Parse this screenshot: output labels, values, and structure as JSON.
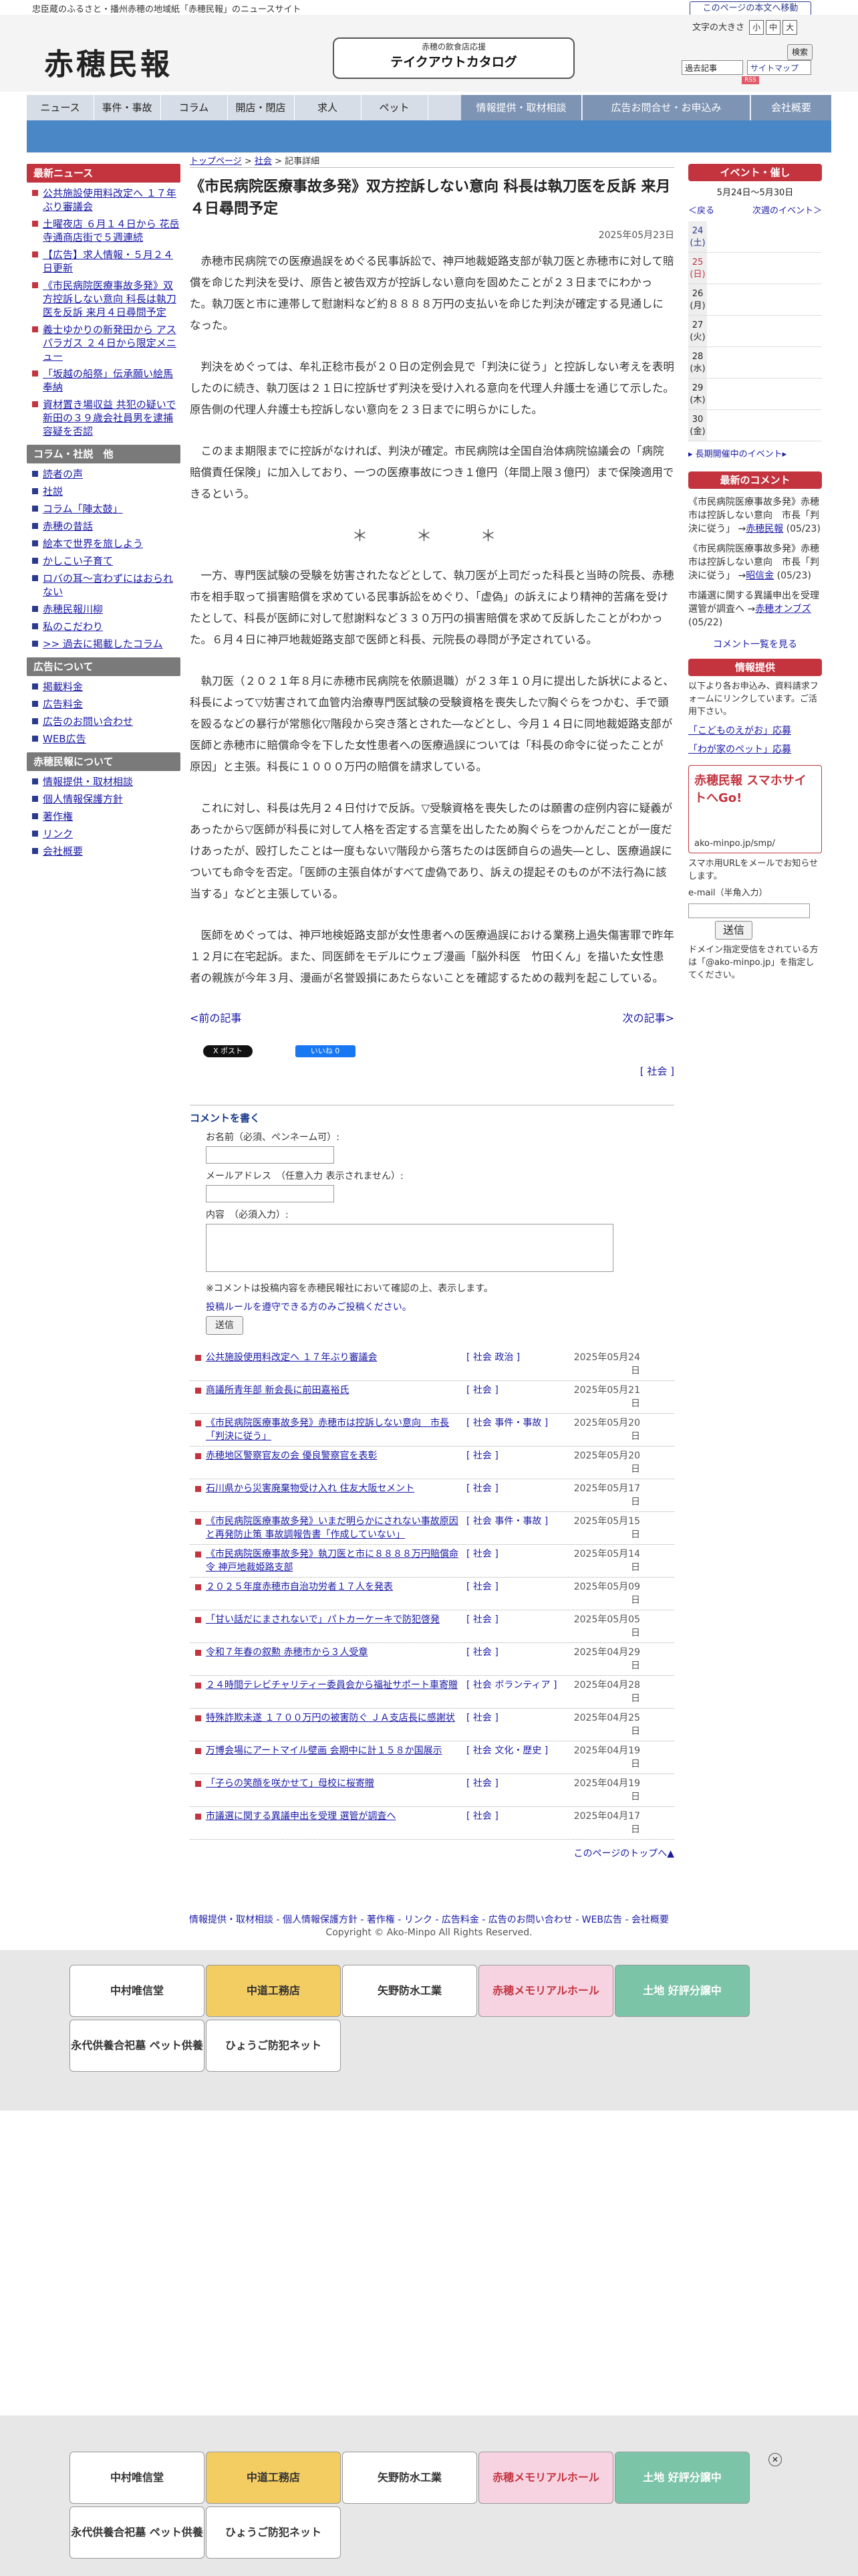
{
  "tagline": "忠臣蔵のふるさと・播州赤穂の地域紙「赤穂民報」のニュースサイト",
  "skip_link": "このページの本文へ移動",
  "logo": "赤穂民報",
  "catalog": {
    "small": "赤穂の飲食店応援",
    "big": "テイクアウトカタログ"
  },
  "fontsize": {
    "label": "文字の大きさ",
    "small": "小",
    "medium": "中",
    "large": "大"
  },
  "search": {
    "button": "検索",
    "select": "過去記事",
    "sitemap": "サイトマップ",
    "rss": "RSS"
  },
  "nav": [
    "ニュース",
    "事件・事故",
    "コラム",
    "開店・閉店",
    "求人",
    "ペット",
    "情報提供・取材相談",
    "広告お問合せ・お申込み",
    "会社概要"
  ],
  "left": {
    "latest_head": "最新ニュース",
    "latest": [
      "公共施設使用料改定へ １７年ぶり審議会",
      "土曜夜店 ６月１４日から 花岳寺通商店街で５週連続",
      "【広告】求人情報・５月２４日更新",
      "《市民病院医療事故多発》双方控訴しない意向 科長は執刀医を反訴 来月４日尋問予定",
      "義士ゆかりの新発田から アスパラガス ２４日から限定メニュー",
      "「坂越の船祭」伝承願い絵馬奉納",
      "資材置き場収益 共犯の疑いで新田の３９歳会社員男を逮捕 容疑を否認"
    ],
    "column_head": "コラム・社説　他",
    "columns": [
      "読者の声",
      "社説",
      "コラム「陣太鼓」",
      "赤穂の昔話",
      "絵本で世界を旅しよう",
      "かしこい子育て",
      "ロバの耳〜言わずにはおられない",
      "赤穂民報川柳",
      "私のこだわり",
      ">> 過去に掲載したコラム"
    ],
    "ad_head": "広告について",
    "ads": [
      "掲載料金",
      "広告料金",
      "広告のお問い合わせ",
      "WEB広告"
    ],
    "about_head": "赤穂民報について",
    "about": [
      "情報提供・取材相談",
      "個人情報保護方針",
      "著作権",
      "リンク",
      "会社概要"
    ]
  },
  "breadcrumb": {
    "home": "トップページ",
    "category": "社会",
    "current": "記事詳細"
  },
  "article": {
    "title": "《市民病院医療事故多発》双方控訴しない意向 科長は執刀医を反訴 来月４日尋問予定",
    "date": "2025年05月23日",
    "p1": "赤穂市民病院での医療過誤をめぐる民事訴訟で、神戸地裁姫路支部が執刀医と赤穂市に対して賠償を命じた判決を受け、原告と被告双方が控訴しない意向を固めたことが２３日までにわかった。執刀医と市に連帯して慰謝料など約８８８８万円の支払いを命じた判決が確定する見通しになった。",
    "p2": "判決をめぐっては、牟礼正稔市長が２０日の定例会見で「判決に従う」と控訴しない考えを表明したのに続き、執刀医は２１日に控訴せず判決を受け入れる意向を代理人弁護士を通じて示した。原告側の代理人弁護士も控訴しない意向を２３日までに明らかにした。",
    "p3": "このまま期限までに控訴がなければ、判決が確定。市民病院は全国自治体病院協議会の「病院賠償責任保険」に加入しており、一つの医療事故につき１億円（年間上限３億円）まで保険適用できるという。",
    "stars": "＊　＊　＊",
    "p4": "一方、専門医試験の受験を妨害されたなどとして、執刀医が上司だった科長と当時の院長、赤穂市を相手取って損害賠償を求めている民事訴訟をめぐり、「虚偽」の訴えにより精神的苦痛を受けたとして、科長が医師に対して慰謝料など３３０万円の損害賠償を求めて反訴したことがわかった。６月４日に神戸地裁姫路支部で医師と科長、元院長の尋問が予定されている。",
    "p5": "執刀医（２０２１年８月に赤穂市民病院を依願退職）が２３年１０月に提出した訴状によると、科長によって▽妨害されて血管内治療専門医試験の受験資格を喪失した▽胸ぐらをつかむ、手で頭を殴るなどの暴行が常態化▽階段から突き落とされた―などとし、今月１４日に同地裁姫路支部が医師と赤穂市に賠償命令を下した女性患者への医療過誤については「科長の命令に従ったことが原因」と主張。科長に１０００万円の賠償を請求している。",
    "p6": "これに対し、科長は先月２４日付けで反訴。▽受験資格を喪失したのは願書の症例内容に疑義があったから▽医師が科長に対して人格を否定する言葉を出したため胸ぐらをつかんだことが一度だけあったが、殴打したことは一度もない▽階段から落ちたのは医師自らの過失―とし、医療過誤についても命令を否定。「医師の主張自体がすべて虚偽であり、訴えの提起そのものが不法行為に該当する」などと主張している。",
    "p7": "医師をめぐっては、神戸地検姫路支部が女性患者への医療過誤における業務上過失傷害罪で昨年１２月に在宅起訴。また、同医師をモデルにウェブ漫画「脳外科医　竹田くん」を描いた女性患者の親族が今年３月、漫画が名誉毀損にあたらないことを確認するための裁判を起こしている。",
    "prev": "<前の記事",
    "next": "次の記事>",
    "x_post": "X ポスト",
    "fb_like": "いいね 0",
    "cat_link": "[ 社会 ]"
  },
  "comment": {
    "head": "コメントを書く",
    "name_label": "お名前（必須、ペンネーム可）:",
    "mail_label": "メールアドレス　（任意入力 表示されません）:",
    "body_label": "内容　（必須入力）:",
    "note": "※コメントは投稿内容を赤穂民報社において確認の上、表示します。",
    "rule": "投稿ルールを遵守できる方のみご投稿ください。",
    "submit": "送信"
  },
  "related": [
    {
      "title": "公共施設使用料改定へ １７年ぶり審議会",
      "cat": "[ 社会 政治 ]",
      "date": "2025年05月24日"
    },
    {
      "title": "商議所青年部 新会長に前田嘉裕氏",
      "cat": "[ 社会 ]",
      "date": "2025年05月21日"
    },
    {
      "title": "《市民病院医療事故多発》赤穂市は控訴しない意向　市長「判決に従う」",
      "cat": "[ 社会 事件・事故 ]",
      "date": "2025年05月20日"
    },
    {
      "title": "赤穂地区警察官友の会 優良警察官を表彰",
      "cat": "[ 社会 ]",
      "date": "2025年05月20日"
    },
    {
      "title": "石川県から災害廃棄物受け入れ 住友大阪セメント",
      "cat": "[ 社会 ]",
      "date": "2025年05月17日"
    },
    {
      "title": "《市民病院医療事故多発》いまだ明らかにされない事故原因と再発防止策 事故調報告書「作成していない」",
      "cat": "[ 社会 事件・事故 ]",
      "date": "2025年05月15日"
    },
    {
      "title": "《市民病院医療事故多発》執刀医と市に８８８８万円賠償命令 神戸地裁姫路支部",
      "cat": "[ 社会 ]",
      "date": "2025年05月14日"
    },
    {
      "title": "２０２５年度赤穂市自治功労者１７人を発表",
      "cat": "[ 社会 ]",
      "date": "2025年05月09日"
    },
    {
      "title": "「甘い話だにまされないで」パトカーケーキで防犯啓発",
      "cat": "[ 社会 ]",
      "date": "2025年05月05日"
    },
    {
      "title": "令和７年春の叙勲 赤穂市から３人受章",
      "cat": "[ 社会 ]",
      "date": "2025年04月29日"
    },
    {
      "title": "２４時間テレビチャリティー委員会から福祉サポート車寄贈",
      "cat": "[ 社会 ボランティア ]",
      "date": "2025年04月28日"
    },
    {
      "title": "特殊詐欺未遂 １７００万円の被害防ぐ ＪＡ支店長に感謝状",
      "cat": "[ 社会 ]",
      "date": "2025年04月25日"
    },
    {
      "title": "万博会場にアートマイル壁画 会期中に計１５８か国展示",
      "cat": "[ 社会 文化・歴史 ]",
      "date": "2025年04月19日"
    },
    {
      "title": "「子らの笑顔を咲かせて」母校に桜寄贈",
      "cat": "[ 社会 ]",
      "date": "2025年04月19日"
    },
    {
      "title": "市議選に関する異議申出を受理 選管が調査へ",
      "cat": "[ 社会 ]",
      "date": "2025年04月17日"
    }
  ],
  "backtotop": "このページのトップへ▲",
  "right": {
    "event_head": "イベント・催し",
    "week": "5月24日〜5月30日",
    "prev": "＜戻る",
    "next": "次週のイベント＞",
    "days": [
      {
        "d": "24",
        "w": "(土)",
        "c": "blue"
      },
      {
        "d": "25",
        "w": "(日)",
        "c": "red"
      },
      {
        "d": "26",
        "w": "(月)",
        "c": ""
      },
      {
        "d": "27",
        "w": "(火)",
        "c": ""
      },
      {
        "d": "28",
        "w": "(水)",
        "c": ""
      },
      {
        "d": "29",
        "w": "(木)",
        "c": ""
      },
      {
        "d": "30",
        "w": "(金)",
        "c": ""
      }
    ],
    "long_events": "▸ 長期開催中のイベント▸",
    "comment_head": "最新のコメント",
    "comments": [
      {
        "text": "《市民病院医療事故多発》赤穂市は控訴しない意向　市長「判決に従う」",
        "by": "赤穂民報",
        "date": "(05/23)"
      },
      {
        "text": "《市民病院医療事故多発》赤穂市は控訴しない意向　市長「判決に従う」",
        "by": "昭信金",
        "date": "(05/23)"
      },
      {
        "text": "市議選に関する異議申出を受理 選管が調査へ",
        "by": "赤穂オンブズ",
        "date": "(05/22)"
      }
    ],
    "comment_btn": "コメント一覧を見る",
    "tip_head": "情報提供",
    "tip_text": "以下より各お申込み、資料請求フォームにリンクしています。ご活用下さい。",
    "tip_links": [
      "「こどものえがお」応募",
      "「わが家のペット」応募"
    ],
    "mobile_title": "赤穂民報 スマホサイトへGo!",
    "mobile_url": "ako-minpo.jp/smp/",
    "mobile_text": "スマホ用URLをメールでお知らせします。",
    "mobile_label": "e-mail（半角入力）",
    "mobile_submit": "送信",
    "mobile_note": "ドメイン指定受信をされている方は「@ako-minpo.jp」を指定してください。"
  },
  "footer": {
    "links": "情報提供・取材相談 - 個人情報保護方針 - 著作権 - リンク - 広告料金 - 広告のお問い合わせ - WEB広告 - 会社概要",
    "copyright": "Copyright © Ako-Minpo All Rights Reserved."
  },
  "ads": [
    "中村唯信堂",
    "中道工務店",
    "矢野防水工業",
    "赤穂メモリアルホール",
    "土地 好評分譲中",
    "永代供養合祀墓 ペット供養",
    "ひょうご防犯ネット"
  ]
}
